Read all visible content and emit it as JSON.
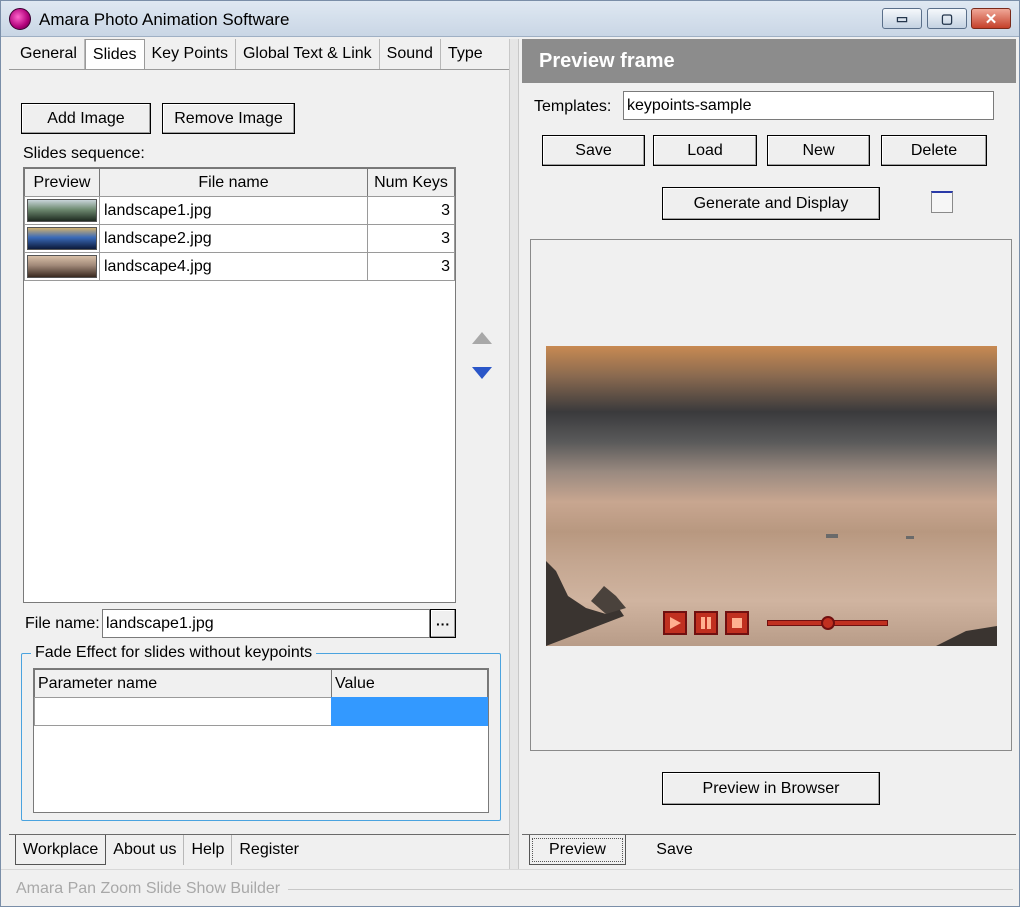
{
  "window": {
    "title": "Amara Photo Animation Software",
    "controls": {
      "minimize": "▭",
      "maximize": "▢",
      "close": "✕"
    }
  },
  "left": {
    "tabs": [
      "General",
      "Slides",
      "Key Points",
      "Global Text & Link",
      "Sound",
      "Type"
    ],
    "active_tab": "Slides",
    "add_image_label": "Add Image",
    "remove_image_label": "Remove Image",
    "slides_sequence_label": "Slides sequence:",
    "table": {
      "headers": [
        "Preview",
        "File name",
        "Num Keys"
      ],
      "rows": [
        {
          "file": "landscape1.jpg",
          "keys": "3",
          "thumb_colors": [
            "#1e2a20",
            "#6e8a70",
            "#c8d4d8"
          ]
        },
        {
          "file": "landscape2.jpg",
          "keys": "3",
          "thumb_colors": [
            "#0c1a3a",
            "#3a6ab8",
            "#d0b070"
          ]
        },
        {
          "file": "landscape4.jpg",
          "keys": "3",
          "thumb_colors": [
            "#3a2a20",
            "#a08878",
            "#d8c0a8"
          ]
        }
      ]
    },
    "file_name_label": "File name:",
    "file_name_value": "landscape1.jpg",
    "browse_label": "···",
    "fade_group_title": "Fade Effect for slides without keypoints",
    "param_headers": [
      "Parameter name",
      "Value"
    ],
    "bottom_tabs": [
      "Workplace",
      "About us",
      "Help",
      "Register"
    ],
    "active_bottom_tab": "Workplace",
    "footer": "Amara Pan Zoom Slide Show Builder"
  },
  "right": {
    "header": "Preview frame",
    "templates_label": "Templates:",
    "templates_value": "keypoints-sample",
    "save_label": "Save",
    "load_label": "Load",
    "new_label": "New",
    "delete_label": "Delete",
    "generate_label": "Generate and Display",
    "preview_browser_label": "Preview in Browser",
    "bottom_tabs": [
      "Preview",
      "Save"
    ],
    "active_bottom_tab": "Preview",
    "player": {
      "slider_position": 0.5
    }
  },
  "colors": {
    "accent_blue": "#3399ff",
    "player_red": "#c03020"
  }
}
